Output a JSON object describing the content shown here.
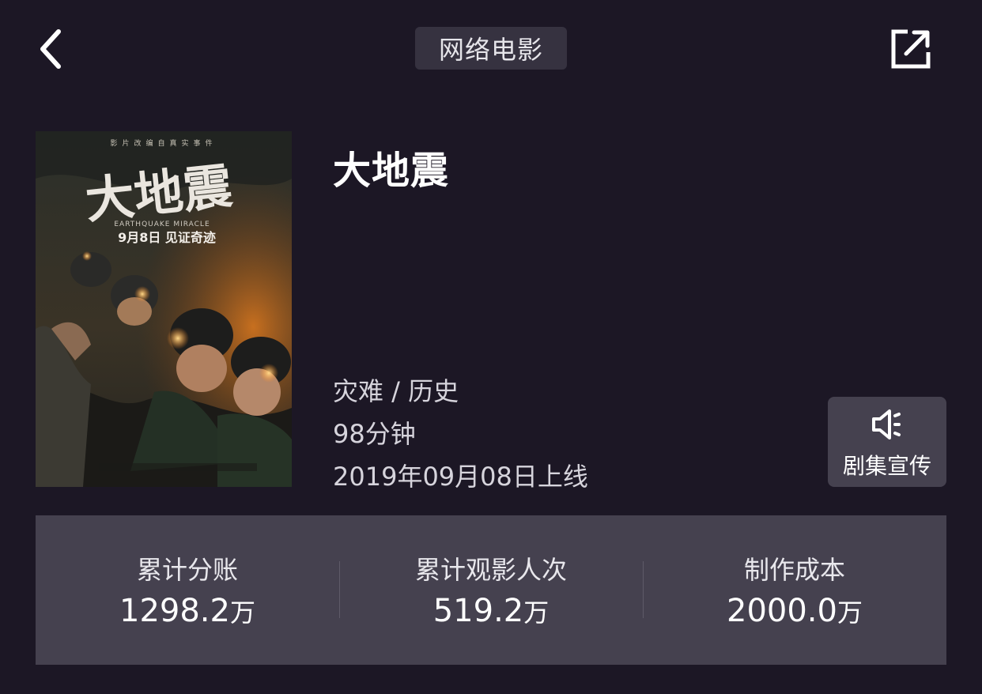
{
  "header": {
    "tag": "网络电影",
    "back_icon": "chevron-left-icon",
    "share_icon": "share-icon"
  },
  "movie": {
    "title": "大地震",
    "genre": "灾难 / 历史",
    "duration": "98分钟",
    "release": "2019年09月08日上线",
    "poster": {
      "top_text": "影片改编自真实事件",
      "title_cn": "大地震",
      "title_en": "EARTHQUAKE MIRACLE",
      "tagline": "9月8日 见证奇迹"
    }
  },
  "promo_button": {
    "label": "剧集宣传",
    "icon": "speaker-icon"
  },
  "stats": [
    {
      "label": "累计分账",
      "value": "1298.2",
      "unit": "万"
    },
    {
      "label": "累计观影人次",
      "value": "519.2",
      "unit": "万"
    },
    {
      "label": "制作成本",
      "value": "2000.0",
      "unit": "万"
    }
  ]
}
